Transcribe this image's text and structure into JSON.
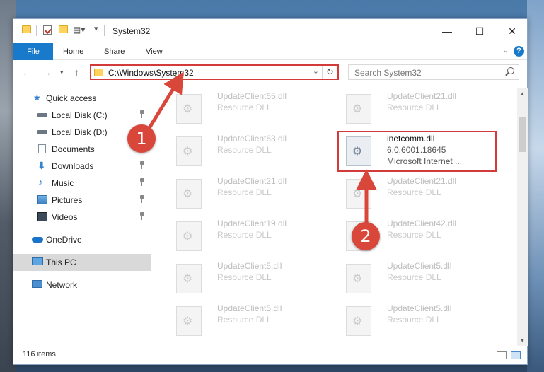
{
  "window": {
    "title": "System32",
    "controls": {
      "minimize": "—",
      "maximize": "☐",
      "close": "✕"
    }
  },
  "ribbon": {
    "tabs": [
      "File",
      "Home",
      "Share",
      "View"
    ],
    "help": "?"
  },
  "address": {
    "path": "C:\\Windows\\System32",
    "search_placeholder": "Search System32"
  },
  "sidebar": {
    "items": [
      {
        "label": "Quick access",
        "icon": "star-icon",
        "pinned": false
      },
      {
        "label": "Local Disk (C:)",
        "icon": "drive-icon",
        "pinned": true
      },
      {
        "label": "Local Disk (D:)",
        "icon": "drive-icon",
        "pinned": false
      },
      {
        "label": "Documents",
        "icon": "documents-icon",
        "pinned": true
      },
      {
        "label": "Downloads",
        "icon": "download-icon",
        "pinned": true
      },
      {
        "label": "Music",
        "icon": "music-icon",
        "pinned": true
      },
      {
        "label": "Pictures",
        "icon": "pictures-icon",
        "pinned": true
      },
      {
        "label": "Videos",
        "icon": "videos-icon",
        "pinned": true
      },
      {
        "label": "OneDrive",
        "icon": "cloud-icon",
        "pinned": false
      },
      {
        "label": "This PC",
        "icon": "computer-icon",
        "pinned": false,
        "selected": true
      },
      {
        "label": "Network",
        "icon": "network-icon",
        "pinned": false
      }
    ]
  },
  "files": [
    {
      "name": "UpdateClient65.dll",
      "desc": "Resource DLL"
    },
    {
      "name": "UpdateClient21.dll",
      "desc": "Resource DLL"
    },
    {
      "name": "UpdateClient63.dll",
      "desc": "Resource DLL"
    },
    {
      "name": "inetcomm.dll",
      "desc": "6.0.6001.18645",
      "desc2": "Microsoft Internet ...",
      "highlighted": true
    },
    {
      "name": "UpdateClient21.dll",
      "desc": "Resource DLL"
    },
    {
      "name": "UpdateClient21.dll",
      "desc": "Resource DLL"
    },
    {
      "name": "UpdateClient19.dll",
      "desc": "Resource DLL"
    },
    {
      "name": "UpdateClient42.dll",
      "desc": "Resource DLL"
    },
    {
      "name": "UpdateClient5.dll",
      "desc": "Resource DLL"
    },
    {
      "name": "UpdateClient5.dll",
      "desc": "Resource DLL"
    },
    {
      "name": "UpdateClient5.dll",
      "desc": "Resource DLL"
    },
    {
      "name": "UpdateClient5.dll",
      "desc": "Resource DLL"
    }
  ],
  "status": {
    "items_count": "116 items"
  },
  "annotations": {
    "marker1": "1",
    "marker2": "2",
    "color": "#d9473b"
  }
}
